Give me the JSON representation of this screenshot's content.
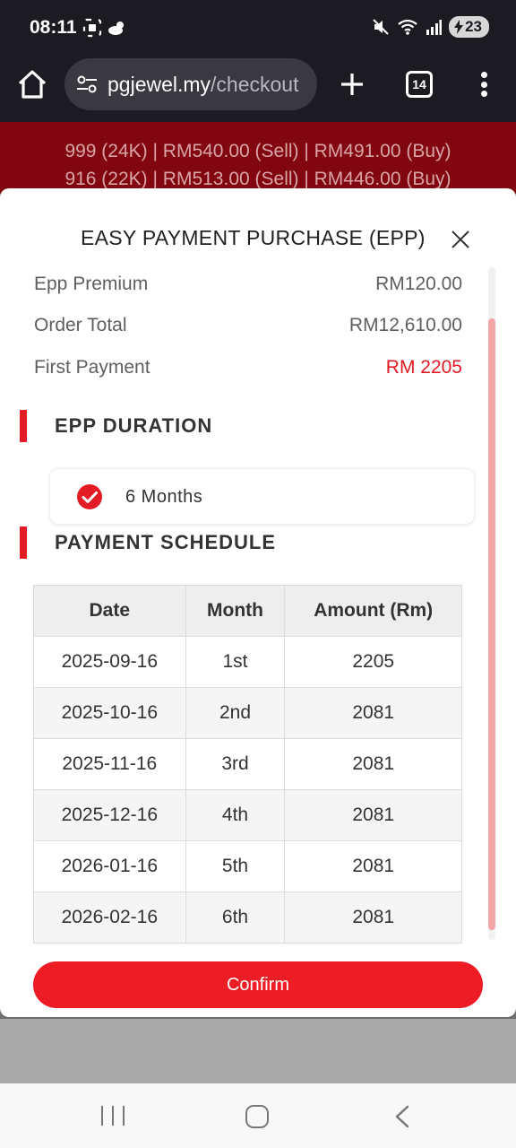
{
  "status_bar": {
    "time": "08:11",
    "battery_level": "23"
  },
  "browser": {
    "url_host": "pgjewel.my",
    "url_path": "/checkout",
    "tab_count": "14"
  },
  "gold_banner": {
    "line1": "999 (24K) | RM540.00 (Sell) | RM491.00 (Buy)",
    "line2": "916 (22K) | RM513.00 (Sell) | RM446.00 (Buy)"
  },
  "modal": {
    "title": "EASY PAYMENT PURCHASE (EPP)",
    "summary": [
      {
        "label": "Epp Premium",
        "value": "RM120.00"
      },
      {
        "label": "Order Total",
        "value": "RM12,610.00"
      },
      {
        "label": "First Payment",
        "value": "RM 2205"
      }
    ],
    "duration_section_title": "EPP DURATION",
    "duration_option": "6 Months",
    "schedule_section_title": "PAYMENT SCHEDULE",
    "schedule_headers": [
      "Date",
      "Month",
      "Amount (Rm)"
    ],
    "schedule_rows": [
      [
        "2025-09-16",
        "1st",
        "2205"
      ],
      [
        "2025-10-16",
        "2nd",
        "2081"
      ],
      [
        "2025-11-16",
        "3rd",
        "2081"
      ],
      [
        "2025-12-16",
        "4th",
        "2081"
      ],
      [
        "2026-01-16",
        "5th",
        "2081"
      ],
      [
        "2026-02-16",
        "6th",
        "2081"
      ]
    ],
    "confirm_label": "Confirm"
  },
  "colors": {
    "accent_red": "#ee1c25",
    "banner_bg": "#820610"
  }
}
